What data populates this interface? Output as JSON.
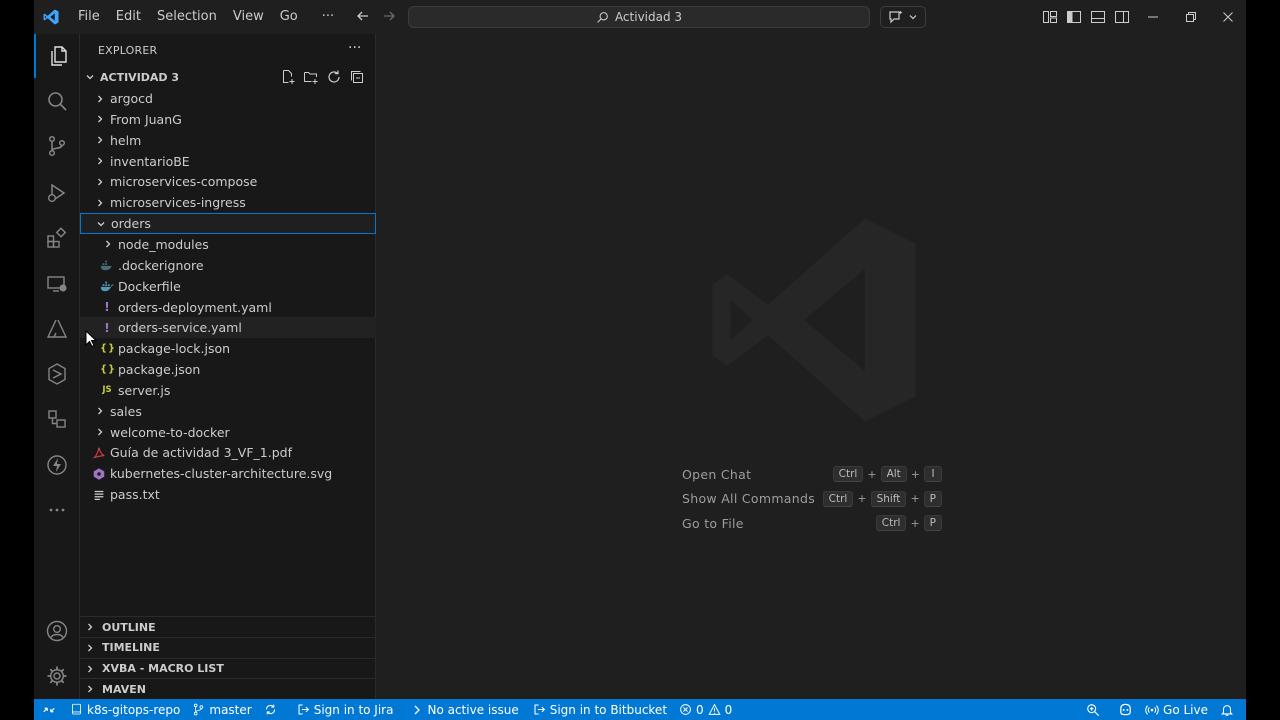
{
  "titlebar": {
    "menu": [
      "File",
      "Edit",
      "Selection",
      "View",
      "Go",
      "···"
    ],
    "search_text": "Actividad 3"
  },
  "explorer": {
    "title": "EXPLORER",
    "more": "···",
    "folder": "ACTIVIDAD 3",
    "items": [
      {
        "label": "argocd",
        "kind": "folder",
        "expanded": false,
        "depth": 0
      },
      {
        "label": "From JuanG",
        "kind": "folder",
        "expanded": false,
        "depth": 0
      },
      {
        "label": "helm",
        "kind": "folder",
        "expanded": false,
        "depth": 0
      },
      {
        "label": "inventarioBE",
        "kind": "folder",
        "expanded": false,
        "depth": 0
      },
      {
        "label": "microservices-compose",
        "kind": "folder",
        "expanded": false,
        "depth": 0
      },
      {
        "label": "microservices-ingress",
        "kind": "folder",
        "expanded": false,
        "depth": 0
      },
      {
        "label": "orders",
        "kind": "folder",
        "expanded": true,
        "depth": 0,
        "selected": true
      },
      {
        "label": "node_modules",
        "kind": "folder",
        "expanded": false,
        "depth": 1
      },
      {
        "label": ".dockerignore",
        "kind": "docker-ignore",
        "depth": 1
      },
      {
        "label": "Dockerfile",
        "kind": "docker",
        "depth": 1
      },
      {
        "label": "orders-deployment.yaml",
        "kind": "yaml",
        "depth": 1
      },
      {
        "label": "orders-service.yaml",
        "kind": "yaml",
        "depth": 1,
        "hover": true
      },
      {
        "label": "package-lock.json",
        "kind": "json",
        "depth": 1
      },
      {
        "label": "package.json",
        "kind": "json",
        "depth": 1
      },
      {
        "label": "server.js",
        "kind": "js",
        "depth": 1
      },
      {
        "label": "sales",
        "kind": "folder",
        "expanded": false,
        "depth": 0
      },
      {
        "label": "welcome-to-docker",
        "kind": "folder",
        "expanded": false,
        "depth": 0
      },
      {
        "label": "Guía de actividad 3_VF_1.pdf",
        "kind": "pdf",
        "depth": 0
      },
      {
        "label": "kubernetes-cluster-architecture.svg",
        "kind": "svg",
        "depth": 0
      },
      {
        "label": "pass.txt",
        "kind": "txt",
        "depth": 0
      }
    ],
    "sections": [
      "OUTLINE",
      "TIMELINE",
      "XVBA - MACRO LIST",
      "MAVEN"
    ]
  },
  "editor": {
    "hints": [
      {
        "label": "Open Chat",
        "keys": [
          "Ctrl",
          "Alt",
          "I"
        ]
      },
      {
        "label": "Show All Commands",
        "keys": [
          "Ctrl",
          "Shift",
          "P"
        ]
      },
      {
        "label": "Go to File",
        "keys": [
          "Ctrl",
          "P"
        ]
      }
    ]
  },
  "statusbar": {
    "repo": "k8s-gitops-repo",
    "branch": "master",
    "jira": "Sign in to Jira",
    "issue": "No active issue",
    "bitbucket": "Sign in to Bitbucket",
    "errors": "0",
    "warnings": "0",
    "golive": "Go Live"
  },
  "colors": {
    "accent": "#0078d4",
    "background": "#1f1f1f",
    "sidebar": "#181818",
    "yaml": "#a074c4",
    "json": "#cbcb41",
    "docker": "#519aba",
    "pdf": "#cc3e44"
  }
}
